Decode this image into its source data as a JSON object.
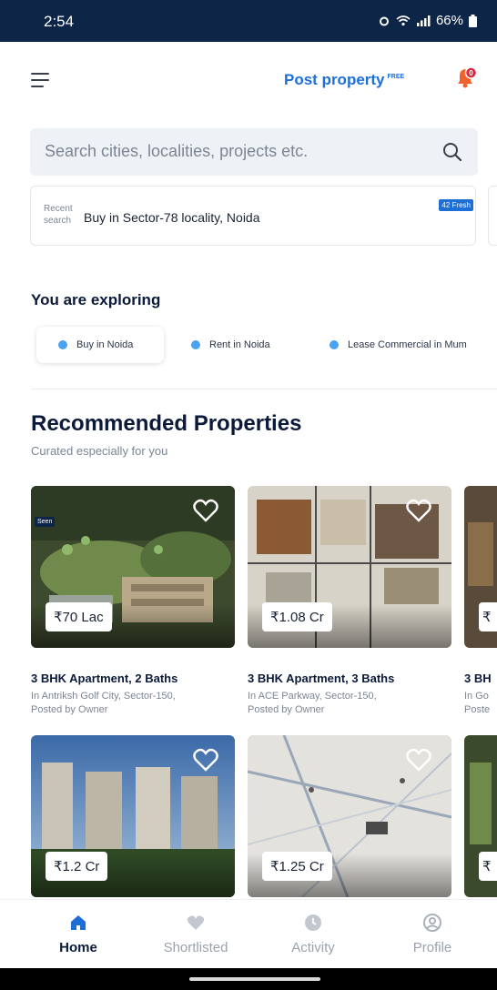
{
  "status": {
    "time": "2:54",
    "battery": "66%"
  },
  "header": {
    "post_label": "Post property",
    "post_badge": "FREE",
    "notification_count": "0"
  },
  "search": {
    "placeholder": "Search cities, localities, projects etc."
  },
  "recent": {
    "label": "Recent search",
    "text": "Buy in Sector-78  locality, Noida",
    "badge": "42 Fresh"
  },
  "exploring": {
    "title": "You are exploring",
    "chips": [
      "Buy in Noida",
      "Rent in Noida",
      "Lease Commercial in Mum"
    ]
  },
  "recommended": {
    "title": "Recommended Properties",
    "subtitle": "Curated especially for you",
    "row1": [
      {
        "price": "₹70 Lac",
        "title": "3 BHK Apartment, 2 Baths",
        "location": "In Antriksh Golf City, Sector-150,",
        "posted": "Posted by Owner",
        "seen": "Seen"
      },
      {
        "price": "₹1.08 Cr",
        "title": "3 BHK Apartment, 3 Baths",
        "location": "In ACE Parkway, Sector-150,",
        "posted": "Posted by Owner"
      },
      {
        "price": "₹",
        "title": "3 BH",
        "location": "In Go",
        "posted": "Poste"
      }
    ],
    "row2": [
      {
        "price": "₹1.2 Cr"
      },
      {
        "price": "₹1.25 Cr"
      },
      {
        "price": "₹"
      }
    ]
  },
  "nav": {
    "items": [
      "Home",
      "Shortlisted",
      "Activity",
      "Profile"
    ]
  },
  "colors": {
    "brand": "#0d2547",
    "accent": "#1d6fd6",
    "bell": "#f2612a"
  },
  "icons": {
    "menu": "hamburger-icon",
    "notify": "bell-icon",
    "search": "search-icon",
    "favorite": "heart-icon",
    "home": "home-icon",
    "shortlist": "heart-icon",
    "activity": "clock-icon",
    "profile": "profile-icon"
  }
}
